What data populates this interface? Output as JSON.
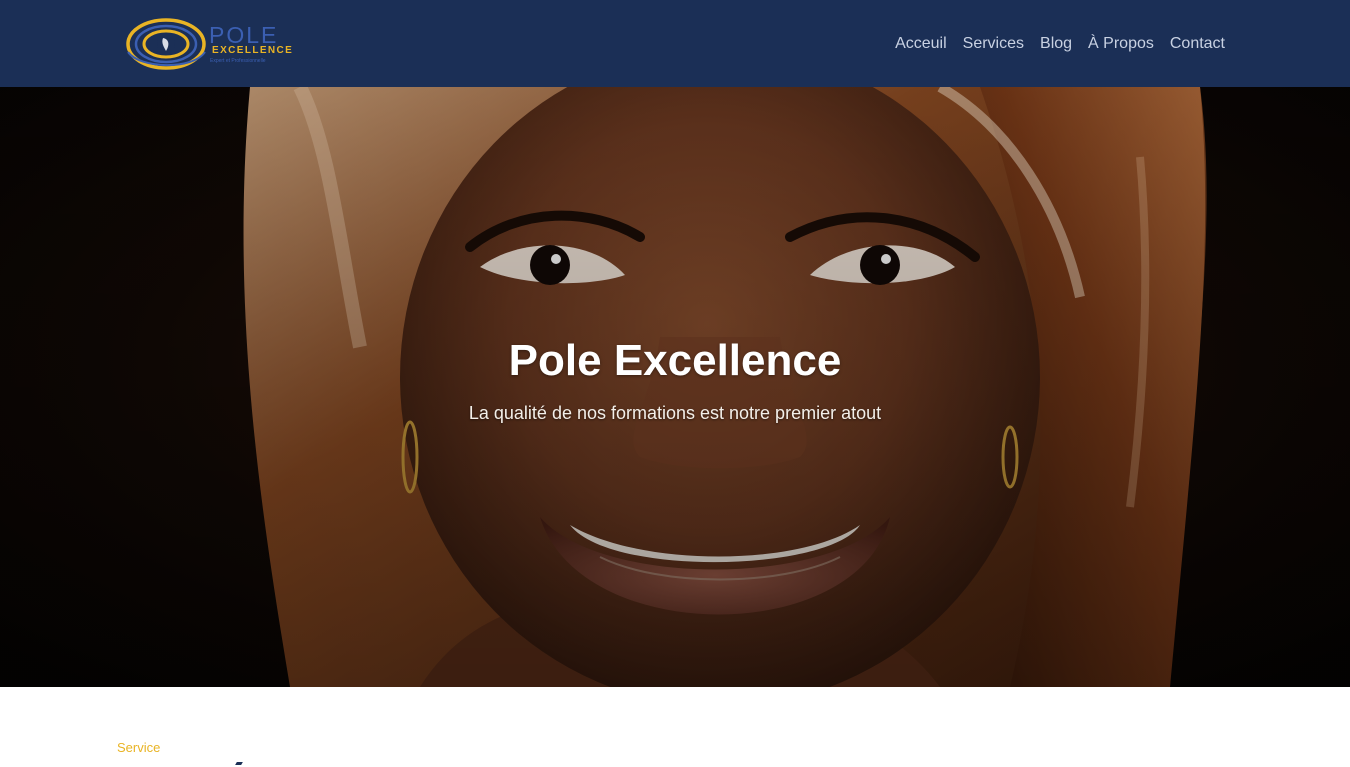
{
  "brand": {
    "logo_word": "POLE",
    "logo_sub": "EXCELLENCE",
    "logo_tag": "Expert et Professionnelle",
    "colors": {
      "navy": "#1b2f56",
      "gold": "#e9b425",
      "logo_blue": "#3b5fb2"
    }
  },
  "nav": {
    "items": [
      {
        "label": "Acceuil"
      },
      {
        "label": "Services"
      },
      {
        "label": "Blog"
      },
      {
        "label": "À Propos"
      },
      {
        "label": "Contact"
      }
    ]
  },
  "hero": {
    "title": "Pole Excellence",
    "subtitle": "La qualité de nos formations est notre premier atout",
    "image": "smiling-woman-portrait"
  },
  "section": {
    "label": "Service"
  }
}
